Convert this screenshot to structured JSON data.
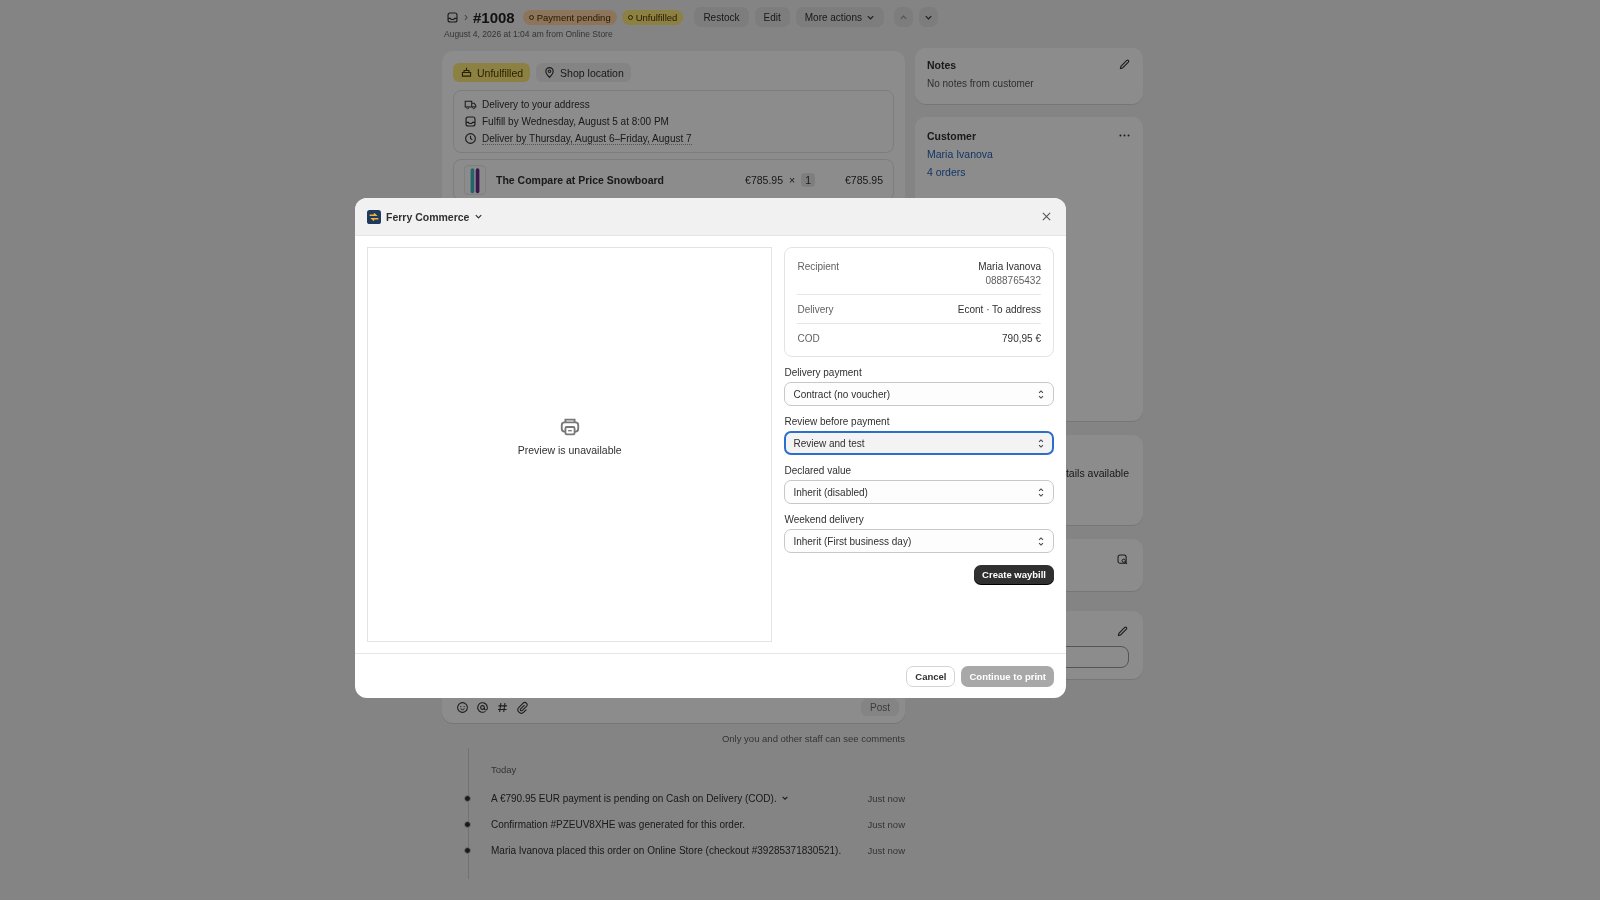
{
  "page": {
    "separator": "›",
    "order_number": "#1008",
    "badges": [
      {
        "label": "Payment pending",
        "kind": "payment"
      },
      {
        "label": "Unfulfilled",
        "kind": "fulfillment"
      }
    ],
    "subtitle": "August 4, 2026 at 1:04 am from Online Store",
    "actions": [
      "Restock",
      "Edit"
    ],
    "more_actions": "More actions"
  },
  "fulfillment": {
    "status": "Unfulfilled",
    "location": "Shop location",
    "details": [
      {
        "kind": "truck",
        "text": "Delivery to your address"
      },
      {
        "kind": "inbox",
        "text": "Fulfill by Wednesday, August 5 at 8:00 PM"
      },
      {
        "kind": "clock",
        "text": "Deliver by Thursday, August 6–Friday, August 7"
      }
    ],
    "line_item": {
      "title": "The Compare at Price Snowboard",
      "price": "€785.95",
      "times": "×",
      "quantity": "1",
      "total": "€785.95"
    }
  },
  "comments": {
    "post": "Post",
    "note": "Only you and other staff can see comments"
  },
  "timeline": {
    "heading": "Today",
    "events": [
      {
        "text": "A €790.95 EUR payment is pending on Cash on Delivery (COD).",
        "time": "Just now",
        "expandable": true
      },
      {
        "text": "Confirmation #PZEUV8XHE was generated for this order.",
        "time": "Just now",
        "expandable": false
      },
      {
        "text": "Maria Ivanova placed this order on Online Store (checkout #39285371830521).",
        "time": "Just now",
        "expandable": false
      }
    ]
  },
  "notes": {
    "title": "Notes",
    "text": "No notes from customer"
  },
  "customer": {
    "title": "Customer",
    "name": "Maria Ivanova",
    "orders": "4 orders"
  },
  "partial_card": {
    "text": "tails available"
  },
  "modal": {
    "provider": "Ferry Commerce",
    "preview": "Preview is unavailable",
    "summary": [
      {
        "label": "Recipient",
        "value": "Maria Ivanova",
        "detail": "0888765432"
      },
      {
        "label": "Delivery",
        "value": "Econt · To address"
      },
      {
        "label": "COD",
        "value": "790,95 €"
      }
    ],
    "fields": [
      {
        "label": "Delivery payment",
        "value": "Contract (no voucher)",
        "focused": false
      },
      {
        "label": "Review before payment",
        "value": "Review and test",
        "focused": true
      },
      {
        "label": "Declared value",
        "value": "Inherit (disabled)",
        "focused": false
      },
      {
        "label": "Weekend delivery",
        "value": "Inherit (First business day)",
        "focused": false
      }
    ],
    "create": "Create waybill",
    "cancel": "Cancel",
    "continue": {
      "label": "Continue to print",
      "disabled": true
    }
  }
}
